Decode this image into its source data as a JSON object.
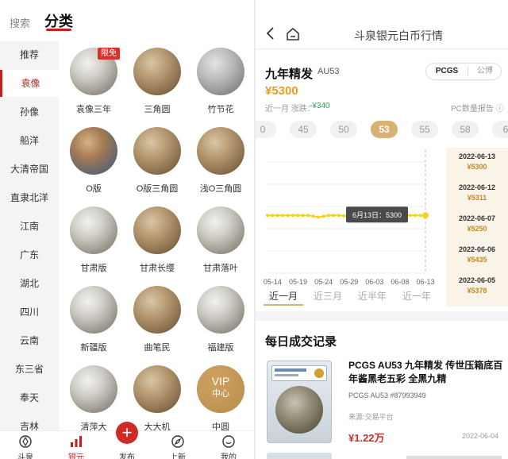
{
  "left": {
    "tabs": {
      "search": "搜索",
      "category": "分类"
    },
    "sidebar": [
      {
        "label": "推荐",
        "active": false
      },
      {
        "label": "袁像",
        "active": true
      },
      {
        "label": "孙像",
        "active": false
      },
      {
        "label": "船洋",
        "active": false
      },
      {
        "label": "大清帝国",
        "active": false
      },
      {
        "label": "直隶北洋",
        "active": false
      },
      {
        "label": "江南",
        "active": false
      },
      {
        "label": "广东",
        "active": false
      },
      {
        "label": "湖北",
        "active": false
      },
      {
        "label": "四川",
        "active": false
      },
      {
        "label": "云南",
        "active": false
      },
      {
        "label": "东三省",
        "active": false
      },
      {
        "label": "奉天",
        "active": false
      },
      {
        "label": "吉林",
        "active": false
      }
    ],
    "coins": [
      {
        "label": "袁像三年",
        "badge": "限免",
        "tone": "silver"
      },
      {
        "label": "三角圆",
        "tone": "toned"
      },
      {
        "label": "竹节花",
        "tone": "grey"
      },
      {
        "label": "O版",
        "tone": "rainbow"
      },
      {
        "label": "O版三角圆",
        "tone": "toned"
      },
      {
        "label": "浅O三角圆",
        "tone": "toned"
      },
      {
        "label": "甘肃版",
        "tone": "silver"
      },
      {
        "label": "甘肃长缨",
        "tone": "toned"
      },
      {
        "label": "甘肃落叶",
        "tone": "silver"
      },
      {
        "label": "新疆版",
        "tone": "silver"
      },
      {
        "label": "曲笔民",
        "tone": "toned"
      },
      {
        "label": "福建版",
        "tone": "silver"
      },
      {
        "label": "清萍大",
        "tone": "silver"
      },
      {
        "label": "大大机",
        "tone": "toned"
      },
      {
        "label": "中圆",
        "tone": "silver",
        "vip": [
          "VIP",
          "中心"
        ]
      }
    ],
    "bottom_nav": [
      {
        "label": "斗泉",
        "icon": "compass-icon",
        "active": false
      },
      {
        "label": "银元",
        "icon": "bar-chart-icon",
        "active": true
      },
      {
        "label": "发布",
        "icon": "plus-icon",
        "active": false
      },
      {
        "label": "上新",
        "icon": "explore-icon",
        "active": false
      },
      {
        "label": "我的",
        "icon": "smile-icon",
        "active": false
      }
    ]
  },
  "right": {
    "header": {
      "title": "斗泉银元白币行情"
    },
    "coin": {
      "name": "九年精发",
      "grade": "AU53",
      "price": "¥5300",
      "change_label": "近一月 涨跌：",
      "change_value": "-¥340",
      "report_label": "PC数量报告 ⓘ"
    },
    "segment": {
      "active": "PCGS",
      "other": "公博"
    },
    "grade_pills": [
      {
        "label": "0",
        "active": false
      },
      {
        "label": "45",
        "active": false
      },
      {
        "label": "50",
        "active": false
      },
      {
        "label": "53",
        "active": true
      },
      {
        "label": "55",
        "active": false
      },
      {
        "label": "58",
        "active": false
      },
      {
        "label": "6",
        "active": false
      }
    ],
    "period_tabs": [
      {
        "label": "近一月",
        "active": true
      },
      {
        "label": "近三月",
        "active": false
      },
      {
        "label": "近半年",
        "active": false
      },
      {
        "label": "近一年",
        "active": false
      }
    ],
    "date_prices": [
      {
        "date": "2022-06-13",
        "price": "¥5300"
      },
      {
        "date": "2022-06-12",
        "price": "¥5311"
      },
      {
        "date": "2022-06-07",
        "price": "¥5250"
      },
      {
        "date": "2022-06-06",
        "price": "¥5435"
      },
      {
        "date": "2022-06-05",
        "price": "¥5378"
      }
    ],
    "section_title": "每日成交记录",
    "record": {
      "title": "PCGS AU53 九年精发 传世压箱底百年酱黑老五彩 全黑九精",
      "cert": "PCGS AU53 #87993949",
      "source": "来源:交易平台",
      "price": "¥1.22万",
      "date": "2022-06-04"
    }
  },
  "chart_data": {
    "type": "line",
    "x": [
      "05-13",
      "05-14",
      "05-15",
      "05-16",
      "05-17",
      "05-18",
      "05-19",
      "05-20",
      "05-21",
      "05-22",
      "05-23",
      "05-24",
      "05-25",
      "05-26",
      "05-27",
      "05-28",
      "05-29",
      "05-30",
      "05-31",
      "06-01",
      "06-02",
      "06-03",
      "06-04",
      "06-05",
      "06-06",
      "06-07",
      "06-08",
      "06-09",
      "06-10",
      "06-11",
      "06-12",
      "06-13"
    ],
    "x_tick_labels": [
      "05-14",
      "05-19",
      "05-24",
      "05-29",
      "06-03",
      "06-08",
      "06-13"
    ],
    "series": [
      {
        "values": [
          5300,
          5300,
          5300,
          5300,
          5300,
          5300,
          5300,
          5300,
          5300,
          5280,
          5260,
          5280,
          5300,
          5300,
          5300,
          5290,
          5280,
          5300,
          5300,
          5300,
          5300,
          5300,
          5300,
          5300,
          5300,
          5300,
          5300,
          5300,
          5300,
          5300,
          5300,
          5300
        ]
      }
    ],
    "tooltip": "6月13日：5300",
    "ylim": [
      4000,
      6500
    ],
    "line_color": "#f2d51a",
    "grid": true
  },
  "colors": {
    "accent": "#c41f1f",
    "gold": "#d8b272",
    "price": "#e4a020"
  }
}
